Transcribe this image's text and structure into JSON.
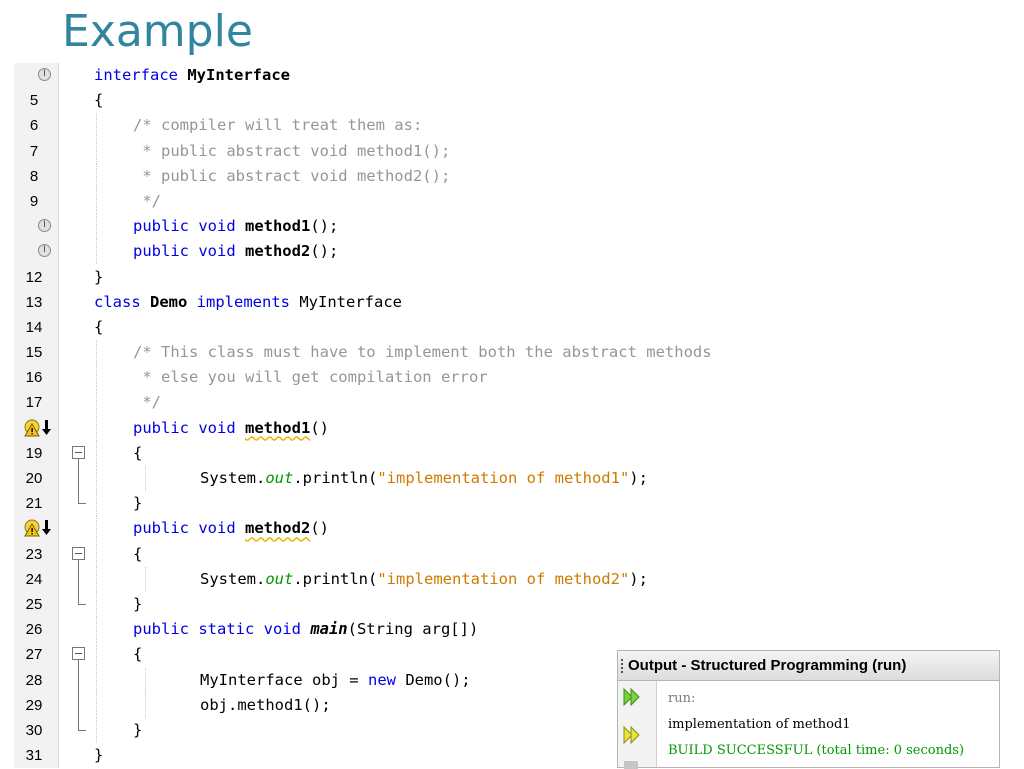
{
  "slide": {
    "title": "Example"
  },
  "editor": {
    "lines": [
      {
        "num": "",
        "marker": "interface-icon",
        "indent": 0,
        "tokens": [
          [
            "kw",
            "interface "
          ],
          [
            "bd",
            "MyInterface"
          ]
        ]
      },
      {
        "num": "5",
        "indent": 0,
        "tokens": [
          [
            "",
            "{"
          ]
        ]
      },
      {
        "num": "6",
        "indent": 1,
        "tokens": [
          [
            "cm",
            "/* compiler will treat them as:"
          ]
        ]
      },
      {
        "num": "7",
        "indent": 1,
        "tokens": [
          [
            "cm",
            " * public abstract void method1();"
          ]
        ]
      },
      {
        "num": "8",
        "indent": 1,
        "tokens": [
          [
            "cm",
            " * public abstract void method2();"
          ]
        ]
      },
      {
        "num": "9",
        "indent": 1,
        "tokens": [
          [
            "cm",
            " */"
          ]
        ]
      },
      {
        "num": "",
        "marker": "interface-icon",
        "indent": 1,
        "tokens": [
          [
            "kw",
            "public void "
          ],
          [
            "bd",
            "method1"
          ],
          [
            "",
            "();"
          ]
        ]
      },
      {
        "num": "",
        "marker": "interface-icon",
        "indent": 1,
        "tokens": [
          [
            "kw",
            "public void "
          ],
          [
            "bd",
            "method2"
          ],
          [
            "",
            "();"
          ]
        ]
      },
      {
        "num": "12",
        "indent": 0,
        "tokens": [
          [
            "",
            "}"
          ]
        ]
      },
      {
        "num": "13",
        "indent": 0,
        "tokens": [
          [
            "kw",
            "class "
          ],
          [
            "bd",
            "Demo "
          ],
          [
            "kw",
            "implements "
          ],
          [
            "",
            "MyInterface"
          ]
        ]
      },
      {
        "num": "14",
        "indent": 0,
        "tokens": [
          [
            "",
            "{"
          ]
        ]
      },
      {
        "num": "15",
        "indent": 1,
        "tokens": [
          [
            "cm",
            "/* This class must have to implement both the abstract methods"
          ]
        ]
      },
      {
        "num": "16",
        "indent": 1,
        "tokens": [
          [
            "cm",
            " * else you will get compilation error"
          ]
        ]
      },
      {
        "num": "17",
        "indent": 1,
        "tokens": [
          [
            "cm",
            " */"
          ]
        ]
      },
      {
        "num": "",
        "marker": "implements-warning-icon",
        "indent": 1,
        "tokens": [
          [
            "kw",
            "public void "
          ],
          [
            "bd wu",
            "method1"
          ],
          [
            "",
            "()"
          ]
        ]
      },
      {
        "num": "19",
        "fold": "start",
        "indent": 1,
        "tokens": [
          [
            "",
            "{"
          ]
        ]
      },
      {
        "num": "20",
        "fold": "mid",
        "indent": 2,
        "tokens": [
          [
            "",
            "System."
          ],
          [
            "fl",
            "out"
          ],
          [
            "",
            ".println("
          ],
          [
            "st",
            "\"implementation of method1\""
          ],
          [
            "",
            ");"
          ]
        ]
      },
      {
        "num": "21",
        "fold": "end",
        "indent": 1,
        "tokens": [
          [
            "",
            "}"
          ]
        ]
      },
      {
        "num": "",
        "marker": "implements-warning-icon",
        "indent": 1,
        "tokens": [
          [
            "kw",
            "public void "
          ],
          [
            "bd wu",
            "method2"
          ],
          [
            "",
            "()"
          ]
        ]
      },
      {
        "num": "23",
        "fold": "start",
        "indent": 1,
        "tokens": [
          [
            "",
            "{"
          ]
        ]
      },
      {
        "num": "24",
        "fold": "mid",
        "indent": 2,
        "tokens": [
          [
            "",
            "System."
          ],
          [
            "fl",
            "out"
          ],
          [
            "",
            ".println("
          ],
          [
            "st",
            "\"implementation of method2\""
          ],
          [
            "",
            ");"
          ]
        ]
      },
      {
        "num": "25",
        "fold": "end",
        "indent": 1,
        "tokens": [
          [
            "",
            "}"
          ]
        ]
      },
      {
        "num": "26",
        "indent": 1,
        "tokens": [
          [
            "kw",
            "public static void "
          ],
          [
            "mi",
            "main"
          ],
          [
            "",
            "(String arg[])"
          ]
        ]
      },
      {
        "num": "27",
        "fold": "start",
        "indent": 1,
        "tokens": [
          [
            "",
            "{"
          ]
        ]
      },
      {
        "num": "28",
        "fold": "mid",
        "indent": 2,
        "tokens": [
          [
            "",
            "MyInterface obj = "
          ],
          [
            "kw",
            "new "
          ],
          [
            "",
            "Demo();"
          ]
        ]
      },
      {
        "num": "29",
        "fold": "mid",
        "indent": 2,
        "tokens": [
          [
            "",
            "obj.method1();"
          ]
        ]
      },
      {
        "num": "30",
        "fold": "end",
        "indent": 1,
        "tokens": [
          [
            "",
            "}"
          ]
        ]
      },
      {
        "num": "31",
        "indent": 0,
        "tokens": [
          [
            "",
            "}"
          ]
        ]
      }
    ]
  },
  "output": {
    "title": "Output - Structured Programming (run)",
    "lines": [
      {
        "text": "run:",
        "color": "#7a7a7a"
      },
      {
        "text": "implementation of method1",
        "color": "#000000"
      },
      {
        "text": "BUILD SUCCESSFUL (total time: 0 seconds)",
        "color": "#009900"
      }
    ],
    "buttons": [
      "rerun-icon",
      "rerun-with-args-icon",
      "stop-icon"
    ]
  },
  "colors": {
    "title": "#31859c",
    "keyword": "#0000e6",
    "comment": "#969696",
    "string": "#ce7b00",
    "field": "#009900",
    "success": "#009900"
  }
}
